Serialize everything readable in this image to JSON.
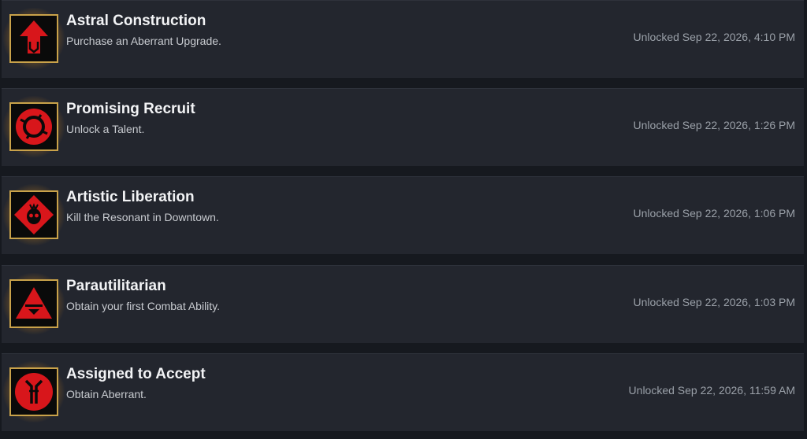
{
  "achievements": [
    {
      "icon": "red-arrow-up-icon",
      "title": "Astral Construction",
      "description": "Purchase an Aberrant Upgrade.",
      "unlocked": "Unlocked Sep 22, 2026, 4:10 PM"
    },
    {
      "icon": "red-ring-emblem-icon",
      "title": "Promising Recruit",
      "description": "Unlock a Talent.",
      "unlocked": "Unlocked Sep 22, 2026, 1:26 PM"
    },
    {
      "icon": "red-diamond-skull-icon",
      "title": "Artistic Liberation",
      "description": "Kill the Resonant in Downtown.",
      "unlocked": "Unlocked Sep 22, 2026, 1:06 PM"
    },
    {
      "icon": "red-triangle-icon",
      "title": "Parautilitarian",
      "description": "Obtain your first Combat Ability.",
      "unlocked": "Unlocked Sep 22, 2026, 1:03 PM"
    },
    {
      "icon": "red-circle-sigil-icon",
      "title": "Assigned to Accept",
      "description": "Obtain Aberrant.",
      "unlocked": "Unlocked Sep 22, 2026, 11:59 AM"
    }
  ],
  "colors": {
    "background": "#16191f",
    "row": "#23262e",
    "icon_red": "#d8161b",
    "icon_frame": "#c9a24a",
    "title": "#f2f3f5",
    "description": "#c8cbd0",
    "timestamp": "#9aa0a8"
  }
}
